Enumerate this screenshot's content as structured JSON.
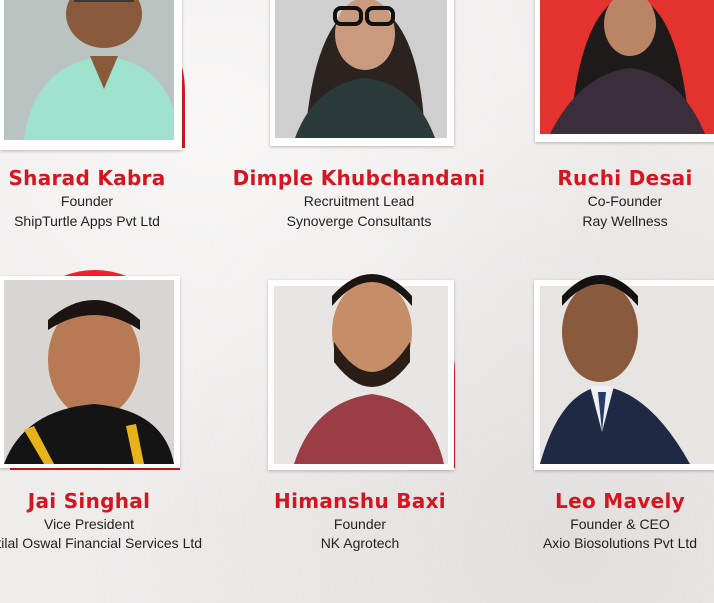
{
  "people": [
    {
      "name": "Sharad Kabra",
      "role": "Founder",
      "company": "ShipTurtle Apps Pvt Ltd"
    },
    {
      "name": "Dimple Khubchandani",
      "role": "Recruitment Lead",
      "company": "Synoverge Consultants"
    },
    {
      "name": "Ruchi Desai",
      "role": "Co-Founder",
      "company": "Ray Wellness"
    },
    {
      "name": "Jai Singhal",
      "role": "Vice President",
      "company": "Motilal Oswal Financial Services Ltd"
    },
    {
      "name": "Himanshu Baxi",
      "role": "Founder",
      "company": "NK Agrotech"
    },
    {
      "name": "Leo Mavely",
      "role": "Founder & CEO",
      "company": "Axio Biosolutions Pvt Ltd"
    }
  ],
  "colors": {
    "accent": "#d7141f",
    "arc": "#f0212a",
    "background": "#efedec"
  }
}
